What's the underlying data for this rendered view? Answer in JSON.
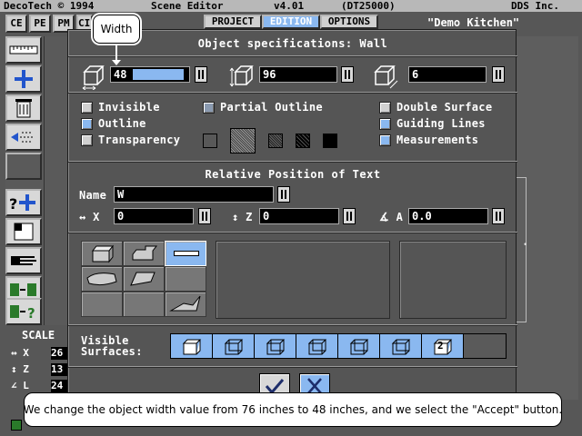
{
  "menubar": {
    "left": "DecoTech © 1994",
    "center": "Scene Editor",
    "version": "v4.01",
    "code": "(DT25000)",
    "right": "DDS Inc."
  },
  "top_tabs": {
    "left": [
      "CE",
      "PE",
      "PM",
      "CI"
    ],
    "right": [
      "PROJECT",
      "EDITION",
      "OPTIONS"
    ]
  },
  "scene_name": "\"Demo Kitchen\"",
  "callout": {
    "text": "Width"
  },
  "dialog": {
    "title": "Object specifications: Wall",
    "width": "48",
    "height": "96",
    "depth": "6",
    "checks": [
      {
        "label": "Invisible",
        "checked": false
      },
      {
        "label": "Outline",
        "checked": true
      },
      {
        "label": "Transparency",
        "checked": false
      },
      {
        "label": "Partial Outline",
        "checked": true
      },
      {
        "label": "Double Surface",
        "checked": false
      },
      {
        "label": "Guiding Lines",
        "checked": true
      },
      {
        "label": "Measurements",
        "checked": true
      }
    ],
    "text_section_title": "Relative Position of Text",
    "name_label": "Name",
    "name_value": "W",
    "x_label": "X",
    "x_value": "0",
    "z_label": "Z",
    "z_value": "0",
    "a_label": "A",
    "a_value": "0.0",
    "visible_label_1": "Visible",
    "visible_label_2": "Surfaces:",
    "surfaces": [
      "",
      "",
      "",
      "",
      "",
      "",
      "2"
    ]
  },
  "scale": {
    "title": "SCALE",
    "x_label": "X",
    "x_value": "26",
    "z_label": "Z",
    "z_value": "13",
    "l_label": "L",
    "l_value": "24"
  },
  "caption": "We change the object width value from 76 inches to 48 inches, and we select the \"Accept\" button.",
  "colors": {
    "accent": "#8ab8f0",
    "dialog": "#555555",
    "desktop": "#5a5a5a"
  }
}
